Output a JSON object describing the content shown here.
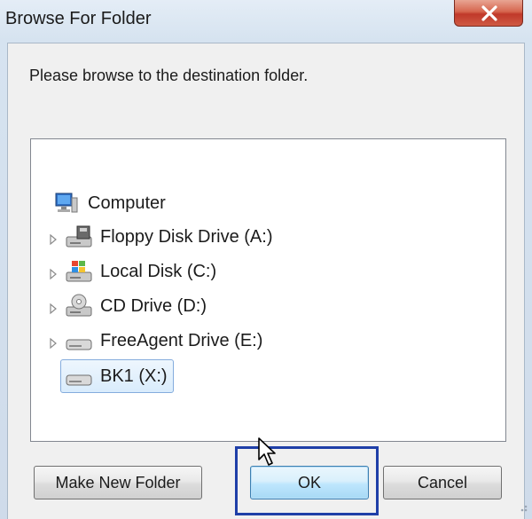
{
  "window": {
    "title": "Browse For Folder",
    "close_icon": "close-icon"
  },
  "instruction": "Please browse to the destination folder.",
  "tree": {
    "items": [
      {
        "label": "Computer",
        "icon": "computer-icon",
        "has_expander": false,
        "selected": false
      },
      {
        "label": "Floppy Disk Drive (A:)",
        "icon": "floppy-drive-icon",
        "has_expander": true,
        "selected": false
      },
      {
        "label": "Local Disk (C:)",
        "icon": "local-disk-icon",
        "has_expander": true,
        "selected": false
      },
      {
        "label": "CD Drive (D:)",
        "icon": "cd-drive-icon",
        "has_expander": true,
        "selected": false
      },
      {
        "label": "FreeAgent Drive (E:)",
        "icon": "external-drive-icon",
        "has_expander": true,
        "selected": false
      },
      {
        "label": "BK1 (X:)",
        "icon": "external-drive-icon",
        "has_expander": false,
        "selected": true
      }
    ]
  },
  "buttons": {
    "make_new_folder": "Make New Folder",
    "ok": "OK",
    "cancel": "Cancel"
  },
  "colors": {
    "highlight_box": "#1f3fa8",
    "close_button": "#c0392a",
    "selection": "#d9ecfc"
  }
}
